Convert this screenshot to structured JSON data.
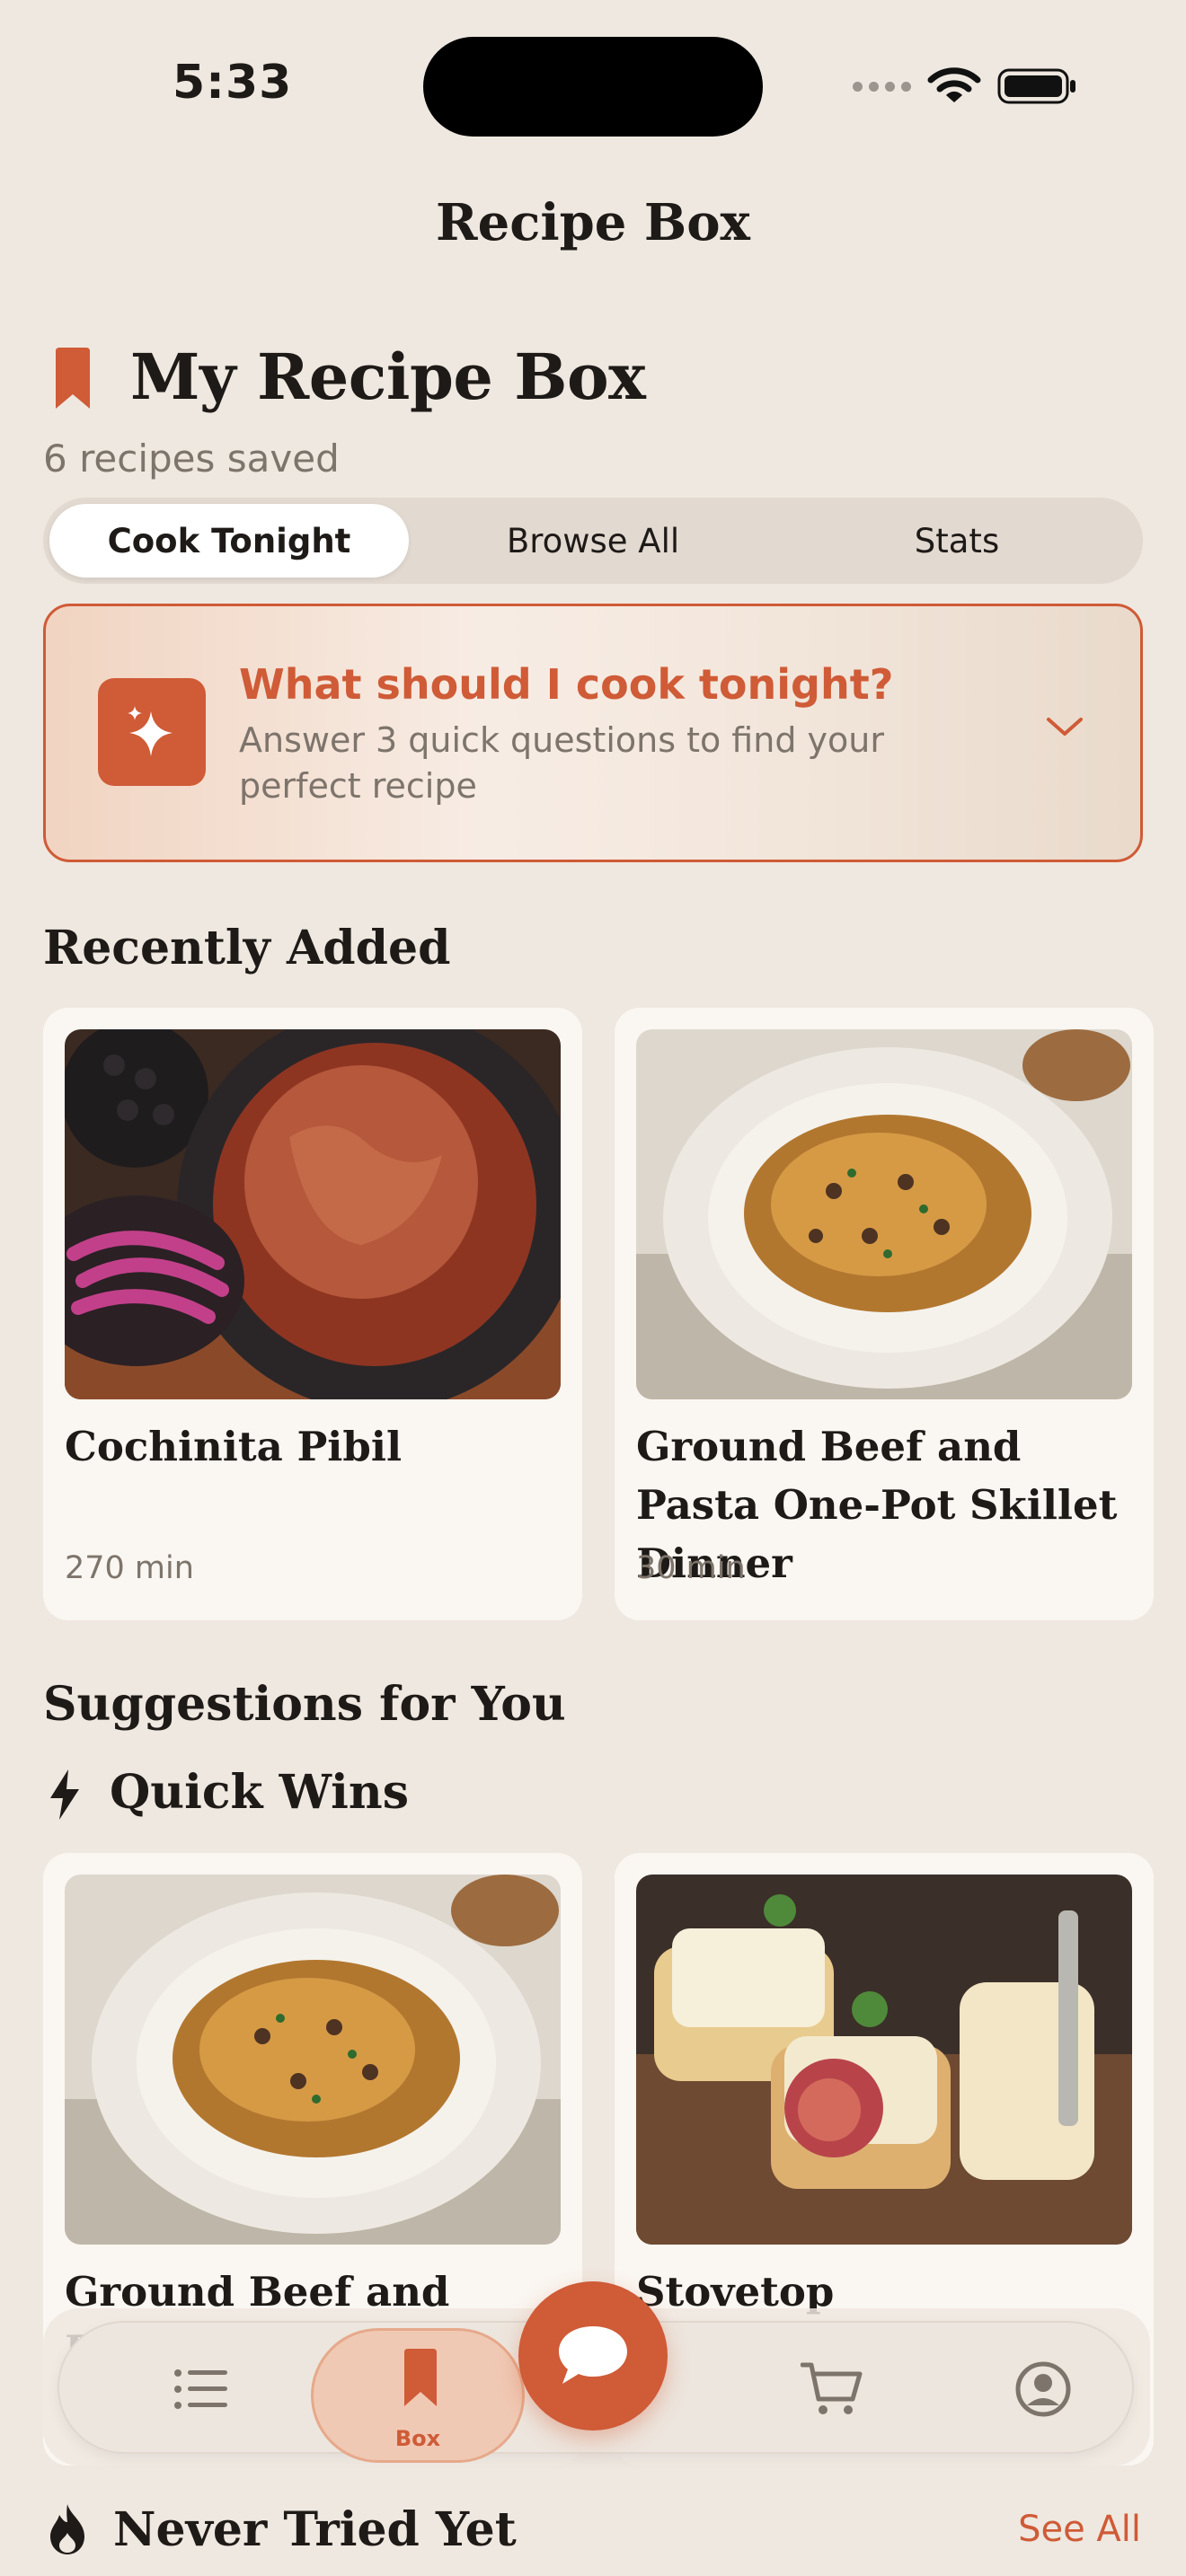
{
  "status_bar": {
    "time": "5:33"
  },
  "nav": {
    "title": "Recipe Box"
  },
  "header": {
    "title": "My Recipe Box",
    "subtitle": "6 recipes saved"
  },
  "segments": [
    {
      "label": "Cook Tonight",
      "active": true
    },
    {
      "label": "Browse All",
      "active": false
    },
    {
      "label": "Stats",
      "active": false
    }
  ],
  "prompt": {
    "title": "What should I cook tonight?",
    "subtitle": "Answer 3 quick questions to find your perfect recipe",
    "icon": "sparkles-icon"
  },
  "recently_added": {
    "title": "Recently Added",
    "items": [
      {
        "name": "Cochinita Pibil",
        "time": "270 min"
      },
      {
        "name": "Ground Beef and Pasta One-Pot Skillet Dinner",
        "time": "30 min"
      }
    ]
  },
  "suggestions": {
    "title": "Suggestions for You",
    "quick_wins": {
      "title": "Quick Wins",
      "items": [
        {
          "name": "Ground Beef and Pasta"
        },
        {
          "name": "Stovetop Cheeseburger"
        }
      ]
    }
  },
  "never_tried": {
    "title": "Never Tried Yet",
    "see_all": "See All"
  },
  "tabbar": {
    "items": [
      {
        "icon": "list-icon"
      },
      {
        "icon": "bookmark-icon",
        "label": "Box",
        "active": true
      },
      {
        "icon": "chat-bubble-icon"
      },
      {
        "icon": "cart-icon"
      },
      {
        "icon": "profile-icon"
      }
    ]
  },
  "colors": {
    "accent": "#CF5B37",
    "background": "#EFE8E0",
    "card": "#FAF6F1",
    "muted_text": "#7D746B"
  }
}
